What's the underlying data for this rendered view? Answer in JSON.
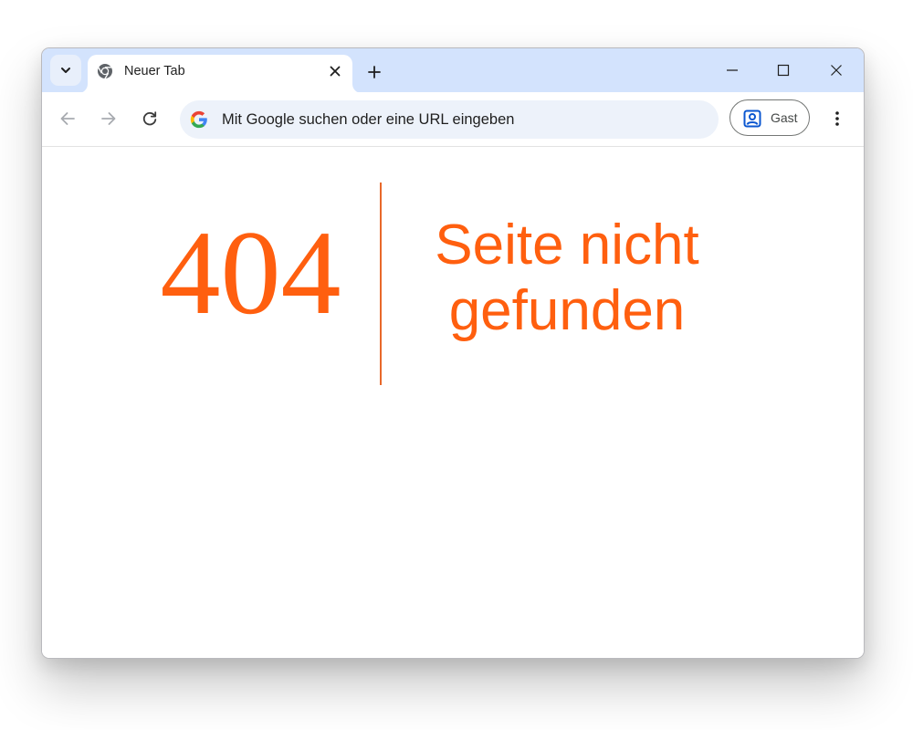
{
  "browser": {
    "tab": {
      "title": "Neuer Tab",
      "favicon": "chrome-icon"
    },
    "window_controls": [
      "minimize-icon",
      "maximize-icon",
      "close-icon"
    ],
    "omnibox": {
      "placeholder": "Mit Google suchen oder eine URL eingeben",
      "value": ""
    },
    "profile": {
      "label": "Gast"
    }
  },
  "page": {
    "error_code": "404",
    "error_message": "Seite nicht gefunden"
  },
  "colors": {
    "accent": "#ff5f0f",
    "divider": "#e8682a",
    "tabstrip": "#d3e3fd",
    "omnibox": "#edf2fa"
  }
}
